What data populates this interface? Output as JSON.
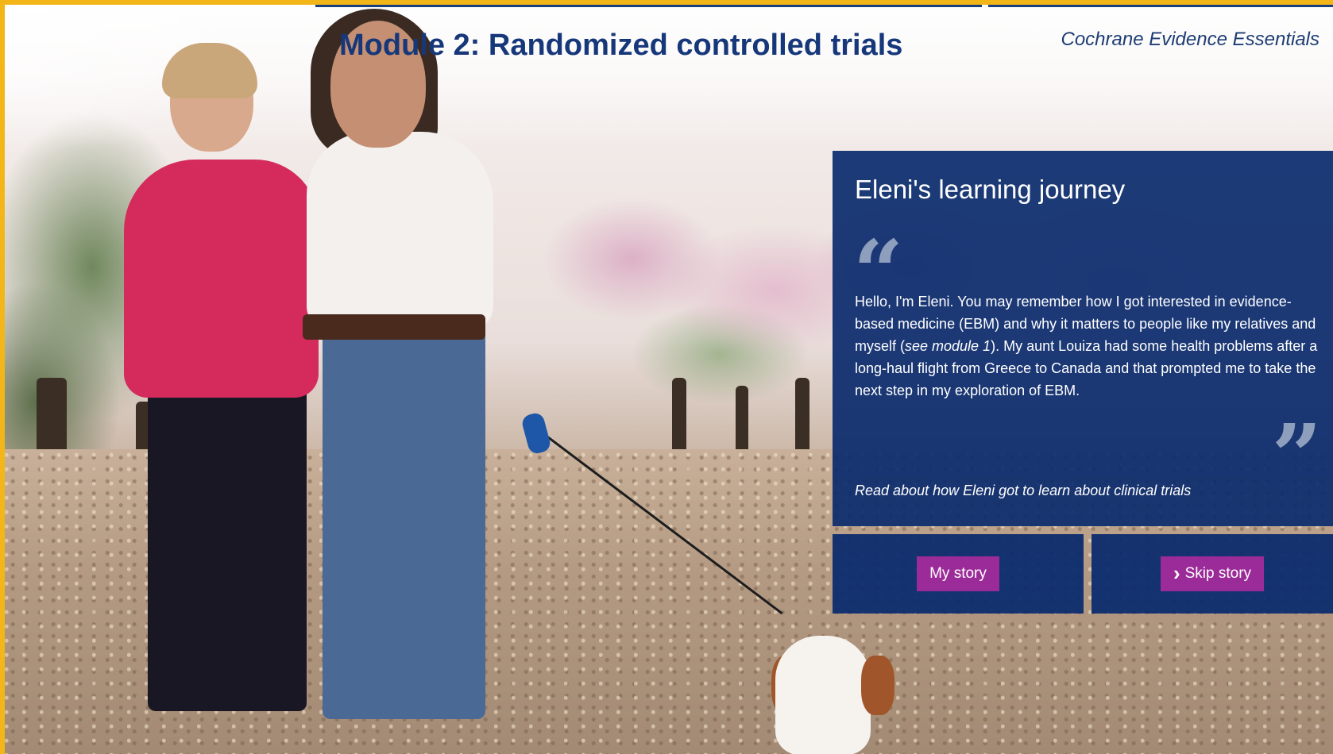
{
  "header": {
    "module_title": "Module 2: Randomized controlled trials",
    "course_name": "Cochrane Evidence Essentials"
  },
  "story_panel": {
    "title": "Eleni's learning journey",
    "quote_open": "“",
    "quote_close": "”",
    "text_part1": "Hello, I'm Eleni. You may remember how I got interested in evidence-based medicine (EBM) and why it matters to people like my relatives and myself (",
    "text_italic": "see module 1",
    "text_part2": "). My aunt Louiza had some health problems after a long-haul flight from Greece to Canada and that prompted me to take the next step in my exploration of EBM.",
    "read_about": "Read about how Eleni got to learn about clinical trials"
  },
  "buttons": {
    "my_story": "My story",
    "skip_story": "Skip story"
  },
  "colors": {
    "frame": "#f2b619",
    "title": "#16387a",
    "panel": "#0c2c6e",
    "button": "#9b2b98"
  }
}
